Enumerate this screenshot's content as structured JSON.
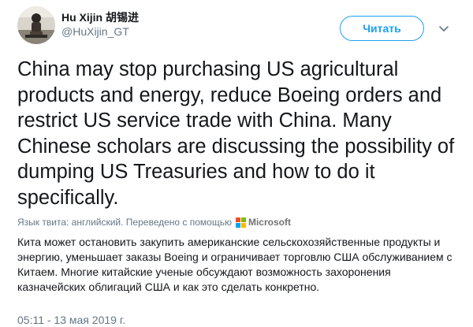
{
  "author": {
    "name": "Hu Xijin 胡锡进",
    "handle": "@HuXijin_GT"
  },
  "actions": {
    "follow_label": "Читать"
  },
  "icons": {
    "avatar": "avatar-photo",
    "caret": "chevron-down-icon",
    "translator_logo": "microsoft-logo"
  },
  "tweet": {
    "text": "China may stop purchasing US agricultural products and energy, reduce Boeing orders and restrict US service trade with China. Many Chinese scholars are discussing the possibility of dumping US Treasuries and how to do it specifically.",
    "translation_meta": "Язык твита: английский. Переведено с помощью",
    "translator_name": "Microsoft",
    "translated_text": "Кита может остановить закупить американские сельскохозяйственные продукты и энергию, уменьшает заказы Boeing и ограничивает торговлю США обслуживанием с Китаем. Многие китайские ученые обсуждают возможность захоронения казначейских облигаций США и как это сделать конкретно.",
    "timestamp": "05:11 - 13 мая 2019 г."
  },
  "colors": {
    "accent": "#1da1f2",
    "text": "#14171a",
    "muted": "#657786",
    "ms_red": "#f25022",
    "ms_green": "#7fba00",
    "ms_blue": "#00a4ef",
    "ms_yellow": "#ffb900"
  }
}
